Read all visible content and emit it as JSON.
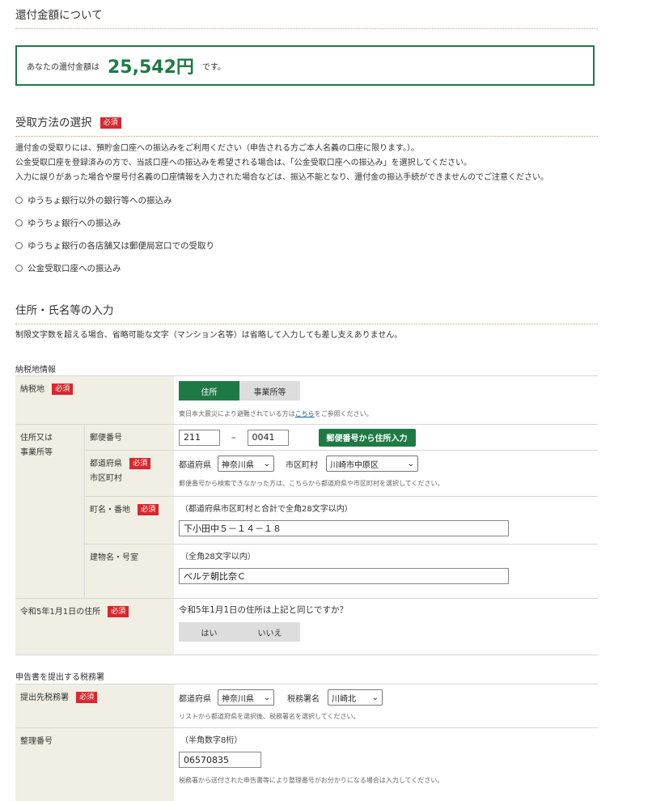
{
  "refund": {
    "section_title": "還付金額について",
    "prefix": "あなたの還付金額は",
    "amount": "25,542円",
    "suffix": "です。"
  },
  "receipt": {
    "section_title": "受取方法の選択",
    "required": "必須",
    "desc1": "還付金の受取りには、預貯金口座への振込みをご利用ください（申告される方ご本人名義の口座に限ります。）。",
    "desc2": "公金受取口座を登録済みの方で、当該口座への振込みを希望される場合は、「公金受取口座への振込み」を選択してください。",
    "desc3": "入力に誤りがあった場合や屋号付名義の口座情報を入力された場合などは、振込不能となり、還付金の振込手続ができませんのでご注意ください。",
    "options": [
      "ゆうちょ銀行以外の銀行等への振込み",
      "ゆうちょ銀行への振込み",
      "ゆうちょ銀行の各店舗又は郵便局窓口での受取り",
      "公金受取口座への振込み"
    ]
  },
  "address": {
    "section_title": "住所・氏名等の入力",
    "desc": "制限文字数を超える場合、省略可能な文字（マンション名等）は省略して入力しても差し支えありません。",
    "tax_place_heading": "納税地情報",
    "required": "必須",
    "tax_place_label": "納税地",
    "toggle_home": "住所",
    "toggle_office": "事業所等",
    "disaster_note_pre": "東日本大震災により避難されている方は",
    "disaster_note_link": "こちら",
    "disaster_note_post": "をご参照ください。",
    "addr_label_line1": "住所又は",
    "addr_label_line2": "事業所等",
    "postal_label": "郵便番号",
    "postal1": "211",
    "postal_dash": "–",
    "postal2": "0041",
    "postal_button": "郵便番号から住所入力",
    "pref_city_label1": "都道府県",
    "pref_city_label2": "市区町村",
    "pref_label": "都道府県",
    "pref_value": "神奈川県",
    "city_label": "市区町村",
    "city_value": "川崎市中原区",
    "pref_note": "郵便番号から検索できなかった方は、こちらから都道府県や市区町村を選択してください。",
    "town_label": "町名・番地",
    "town_hint": "（都道府県市区町村と合計で全角28文字以内）",
    "town_value": "下小田中５－１４－１８",
    "building_label": "建物名・号室",
    "building_hint": "（全角28文字以内）",
    "building_value": "ベルテ朝比奈Ｃ",
    "reiwa_label": "令和5年1月1日の住所",
    "reiwa_question": "令和5年1月1日の住所は上記と同じですか？",
    "yes": "はい",
    "no": "いいえ"
  },
  "tax_office": {
    "heading": "申告書を提出する税務署",
    "required": "必須",
    "office_label": "提出先税務署",
    "pref_label": "都道府県",
    "pref_value": "神奈川県",
    "office_name_label": "税務署名",
    "office_value": "川崎北",
    "office_note": "リストから都道府県を選択後、税務署名を選択してください。",
    "ref_label": "整理番号",
    "ref_hint": "（半角数字8桁）",
    "ref_value": "06570835",
    "ref_note": "税務署から送付された申告書等により整理番号がお分かりになる場合は入力してください。"
  }
}
